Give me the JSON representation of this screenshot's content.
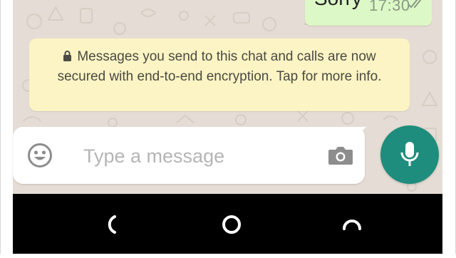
{
  "chat": {
    "last_message": {
      "text": "Sorry",
      "time": "17:30",
      "status_icon": "double-check-icon"
    },
    "encryption_notice": {
      "icon": "lock-icon",
      "text": "Messages you send to this chat and calls are now secured with end-to-end encryption. Tap for more info."
    }
  },
  "composer": {
    "placeholder": "Type a message",
    "emoji_icon": "emoji-icon",
    "camera_icon": "camera-icon",
    "mic_icon": "mic-icon"
  },
  "system_nav": {
    "back_icon": "back-icon",
    "home_icon": "home-icon",
    "recents_icon": "recents-icon"
  },
  "colors": {
    "wallpaper": "#e5ddd5",
    "outgoing_bubble": "#dcf8c6",
    "notice_bubble": "#fcf4c4",
    "accent": "#1e8d7d",
    "nav_bar": "#000000"
  }
}
